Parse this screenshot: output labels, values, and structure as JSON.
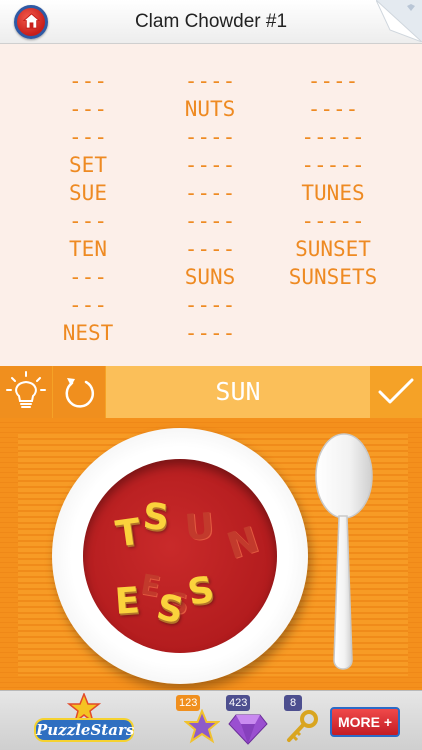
{
  "header": {
    "title": "Clam Chowder #1"
  },
  "word_list": {
    "columns": [
      [
        "---",
        "---",
        "---",
        "SET",
        "SUE",
        "---",
        "TEN",
        "---",
        "---",
        "NEST"
      ],
      [
        "----",
        "NUTS",
        "----",
        "----",
        "----",
        "----",
        "----",
        "SUNS",
        "----",
        "----"
      ],
      [
        "----",
        "----",
        "-----",
        "-----",
        "TUNES",
        "-----",
        "SUNSET",
        "SUNSETS"
      ]
    ]
  },
  "controls": {
    "current_word": "SUN",
    "hint_icon": "lightbulb-icon",
    "reset_icon": "refresh-icon",
    "submit_icon": "checkmark-icon"
  },
  "soup_letters": [
    "T",
    "S",
    "U",
    "N",
    "E",
    "S",
    "S",
    "E",
    "S"
  ],
  "bottom_bar": {
    "logo_text": "PuzzleStars",
    "stars_count": "123",
    "gems_count": "423",
    "keys_count": "8",
    "more_label": "MORE"
  },
  "colors": {
    "accent": "#f4901c",
    "word_text": "#ee8a22",
    "soup": "#b31c1e"
  }
}
